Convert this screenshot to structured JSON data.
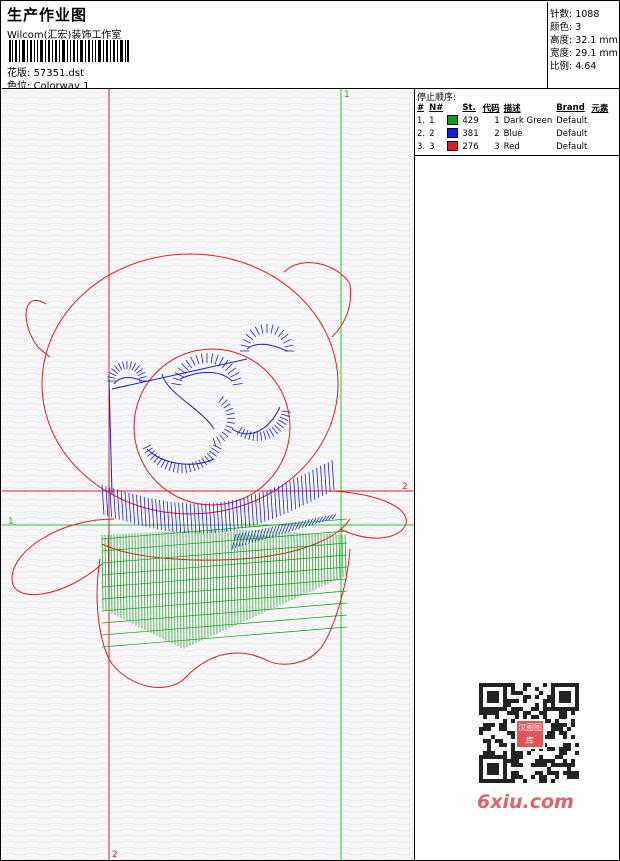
{
  "header": {
    "title": "生产作业图",
    "company": "Wilcom(汇宏)装饰工作室",
    "design_label": "花版:",
    "design_value": "57351.dst",
    "colorway_label": "色位:",
    "colorway_value": "Colorway 1"
  },
  "stats": [
    {
      "label": "针数:",
      "value": "1088"
    },
    {
      "label": "颜色:",
      "value": "3"
    },
    {
      "label": "高度:",
      "value": "32.1 mm"
    },
    {
      "label": "宽度:",
      "value": "29.1 mm"
    },
    {
      "label": "比例:",
      "value": "4.64"
    }
  ],
  "stop_sequence": {
    "title": "停止顺序:",
    "columns": [
      "#",
      "N#",
      "St.",
      "代码",
      "描述",
      "Brand",
      "元素"
    ],
    "rows": [
      {
        "index": "1.",
        "needle": "1",
        "color": "#1a9a1a",
        "stitches": "429",
        "code": "1",
        "desc": "Dark Green",
        "brand": "Default"
      },
      {
        "index": "2.",
        "needle": "2",
        "color": "#1a1ae6",
        "stitches": "381",
        "code": "2",
        "desc": "Blue",
        "brand": "Default"
      },
      {
        "index": "3.",
        "needle": "3",
        "color": "#e61a1a",
        "stitches": "276",
        "code": "3",
        "desc": "Red",
        "brand": "Default"
      }
    ]
  },
  "guides": {
    "v1_label": "1",
    "v2_label": "2",
    "h1_label": "1",
    "h2_label": "2"
  },
  "watermark": {
    "text": "6xiu.com",
    "stamp": "汉图图库"
  }
}
